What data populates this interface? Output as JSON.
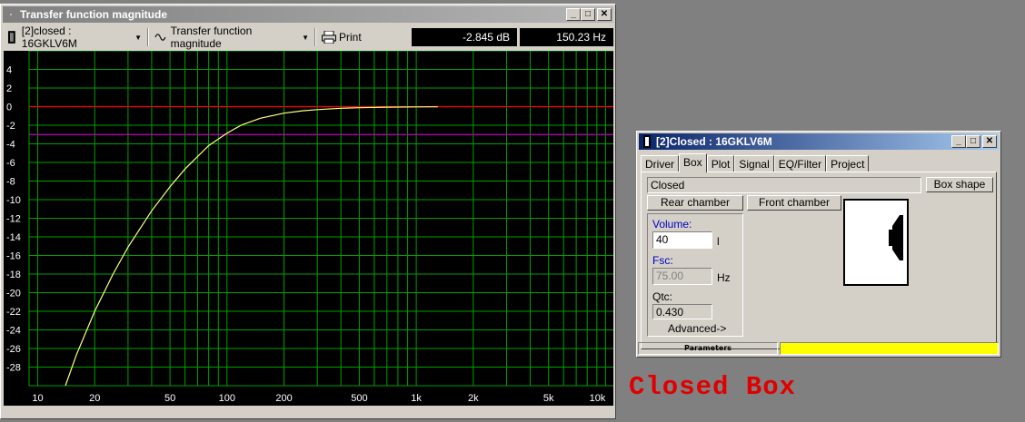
{
  "plot_window": {
    "title": "Transfer function magnitude",
    "driver_select": "[2]closed : 16GKLV6M",
    "view_select": "Transfer function magnitude",
    "print_label": "Print",
    "readout_db": "-2.845 dB",
    "readout_hz": "150.23 Hz"
  },
  "chart_data": {
    "type": "line",
    "xscale": "log",
    "xlim": [
      9,
      11000
    ],
    "ylim": [
      -30,
      6
    ],
    "x_ticks": [
      10,
      20,
      50,
      100,
      200,
      500,
      1000,
      2000,
      5000,
      10000
    ],
    "x_tick_labels": [
      "10",
      "20",
      "50",
      "100",
      "200",
      "500",
      "1k",
      "2k",
      "5k",
      "10k"
    ],
    "y_ticks": [
      4,
      2,
      0,
      -2,
      -4,
      -6,
      -8,
      -10,
      -12,
      -14,
      -16,
      -18,
      -20,
      -22,
      -24,
      -26,
      -28
    ],
    "y_tick_labels": [
      "4",
      "2",
      "0",
      "-2",
      "-4",
      "-6",
      "-8",
      "-10",
      "-12",
      "-14",
      "-16",
      "-18",
      "-20",
      "-22",
      "-24",
      "-26",
      "-28"
    ],
    "grid": true,
    "reference_lines": [
      {
        "y": 0,
        "color": "#ff0000"
      },
      {
        "y": -3,
        "color": "#c000c0"
      }
    ],
    "series": [
      {
        "color": "#ffff80",
        "x": [
          14,
          16,
          20,
          25,
          30,
          40,
          50,
          60,
          80,
          100,
          120,
          150,
          200,
          250,
          300,
          400,
          500,
          700,
          1000,
          1300
        ],
        "y": [
          -30,
          -26.7,
          -22.0,
          -18.0,
          -15.1,
          -11.2,
          -8.6,
          -6.7,
          -4.2,
          -2.85,
          -1.95,
          -1.25,
          -0.7,
          -0.45,
          -0.32,
          -0.18,
          -0.12,
          -0.06,
          -0.03,
          -0.02
        ]
      }
    ]
  },
  "box_window": {
    "title": "[2]Closed : 16GKLV6M",
    "tabs": [
      "Driver",
      "Box",
      "Plot",
      "Signal",
      "EQ/Filter",
      "Project"
    ],
    "box_type": "Closed",
    "box_shape_btn": "Box shape",
    "rear_chamber_btn": "Rear chamber",
    "front_chamber_btn": "Front chamber",
    "volume_label": "Volume:",
    "volume_value": "40",
    "volume_unit": "l",
    "fsc_label": "Fsc:",
    "fsc_value": "75.00",
    "fsc_unit": "Hz",
    "qtc_label": "Qtc:",
    "qtc_value": "0.430",
    "advanced_btn": "Advanced->",
    "status_label": "Parameters"
  },
  "caption": "Closed Box",
  "colors": {
    "grid": "#00a000",
    "caption": "#e00000",
    "status_bar": "#ffff00"
  }
}
